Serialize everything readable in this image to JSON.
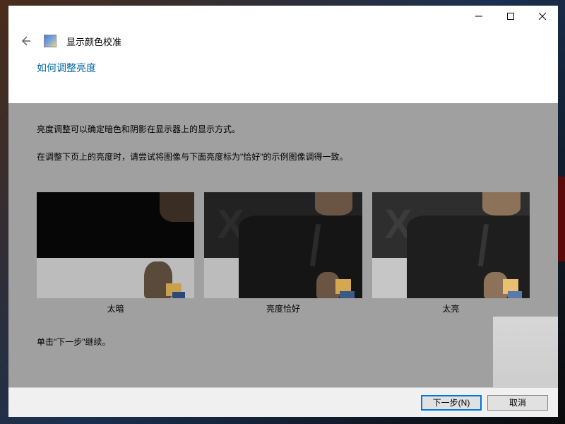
{
  "window": {
    "app_title": "显示颜色校准"
  },
  "content": {
    "heading": "如何调整亮度",
    "para1": "亮度调整可以确定暗色和阴影在显示器上的显示方式。",
    "para2": "在调整下页上的亮度时，请尝试将图像与下面亮度标为\"恰好\"的示例图像调得一致。",
    "continue_text": "单击\"下一步\"继续。"
  },
  "examples": [
    {
      "caption": "太暗"
    },
    {
      "caption": "亮度恰好"
    },
    {
      "caption": "太亮"
    }
  ],
  "footer": {
    "next_label": "下一步(N)",
    "cancel_label": "取消"
  }
}
